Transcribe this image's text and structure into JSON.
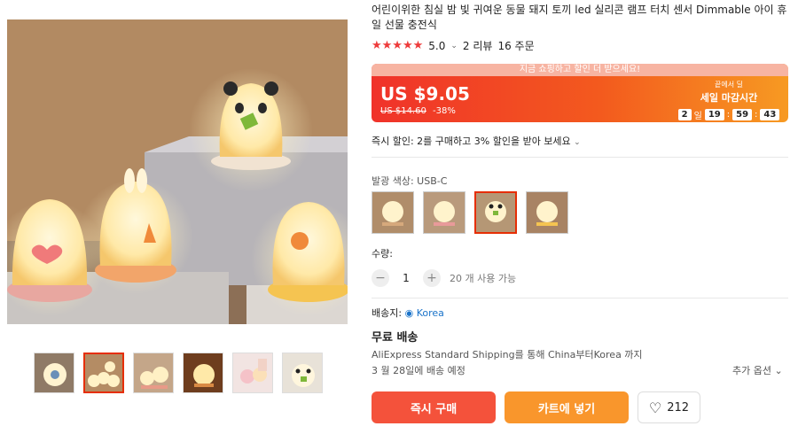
{
  "product": {
    "title": "어린이위한 침실 밤 빛 귀여운 동물 돼지 토끼 led 실리콘 램프 터치 센서 Dimmable 아이 휴일 선물 충전식",
    "stars": "★★★★★",
    "rating": "5.0",
    "reviews": "2 리뷰",
    "orders": "16 주문"
  },
  "price": {
    "banner_top": "지금 쇼핑하고 할인 더 받으세요!",
    "current": "US $9.05",
    "original": "US $14.60",
    "discount": "-38%",
    "sale_sub": "끝에서 딜",
    "sale_title": "세일 마감시간",
    "countdown": {
      "days": "2",
      "day_label": "일",
      "hours": "19",
      "minutes": "59",
      "seconds": "43"
    }
  },
  "instant_discount": "즉시 할인: 2를 구매하고 3% 할인을 받아 보세요",
  "color": {
    "label": "발광 색상: USB-C"
  },
  "quantity": {
    "label": "수량:",
    "value": "1",
    "available": "20 개 사용 가능"
  },
  "shipping": {
    "ship_to_label": "배송지:",
    "location": "Korea",
    "free": "무료 배송",
    "via": "AliExpress Standard Shipping를 통해 China부터Korea 까지",
    "date": "3 월 28일에 배송 예정",
    "more_options": "추가 옵션"
  },
  "actions": {
    "buy_now": "즉시 구매",
    "add_to_cart": "카트에 넣기",
    "wishlist_count": "212"
  },
  "colors": {
    "accent": "#e62e04",
    "buy": "#f4523b",
    "cart": "#f9962c",
    "link": "#1a73c9"
  }
}
